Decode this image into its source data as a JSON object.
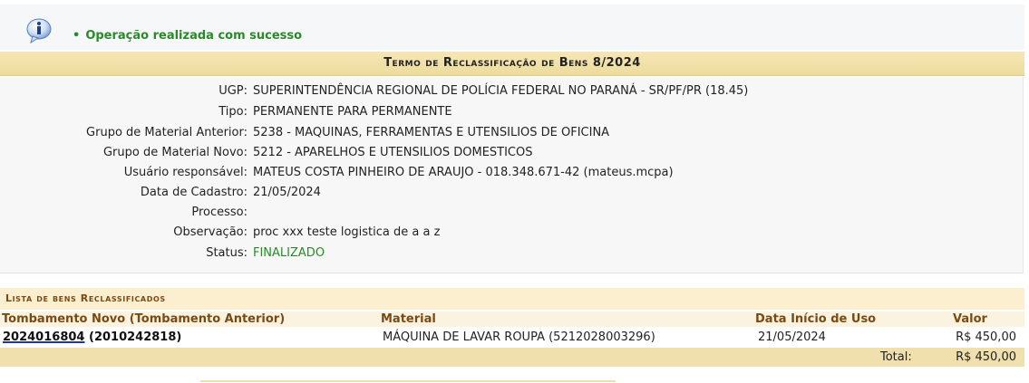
{
  "message": {
    "icon": "info-icon",
    "text": "Operação realizada com sucesso"
  },
  "title": "Termo de Reclassificação de Bens 8/2024",
  "details": [
    {
      "label": "UGP:",
      "value": "SUPERINTENDÊNCIA REGIONAL DE POLÍCIA FEDERAL NO PARANÁ - SR/PF/PR (18.45)"
    },
    {
      "label": "Tipo:",
      "value": "PERMANENTE PARA PERMANENTE"
    },
    {
      "label": "Grupo de Material Anterior:",
      "value": "5238 - MAQUINAS, FERRAMENTAS E UTENSILIOS DE OFICINA"
    },
    {
      "label": "Grupo de Material Novo:",
      "value": "5212 - APARELHOS E UTENSILIOS DOMESTICOS"
    },
    {
      "label": "Usuário responsável:",
      "value": "MATEUS COSTA PINHEIRO DE ARAUJO - 018.348.671-42 (mateus.mcpa)"
    },
    {
      "label": "Data de Cadastro:",
      "value": "21/05/2024"
    },
    {
      "label": "Processo:",
      "value": ""
    },
    {
      "label": "Observação:",
      "value": "proc xxx teste logistica de a a z"
    },
    {
      "label": "Status:",
      "value": "FINALIZADO"
    }
  ],
  "list": {
    "caption": "Lista de bens Reclassificados",
    "columns": [
      "Tombamento Novo (Tombamento Anterior)",
      "Material",
      "Data Início de Uso",
      "Valor"
    ],
    "rows": [
      {
        "tombamento_novo": "2024016804",
        "tombamento_anterior": "(2010242818)",
        "material": "MÁQUINA DE LAVAR ROUPA (5212028003296)",
        "data_inicio": "21/05/2024",
        "valor": "R$ 450,00"
      }
    ],
    "total_label": "Total:",
    "total_value": "R$ 450,00"
  },
  "colors": {
    "success": "#2a8a2a",
    "header_bg": "#f6e6b4",
    "column_header_text": "#7a4a12"
  }
}
